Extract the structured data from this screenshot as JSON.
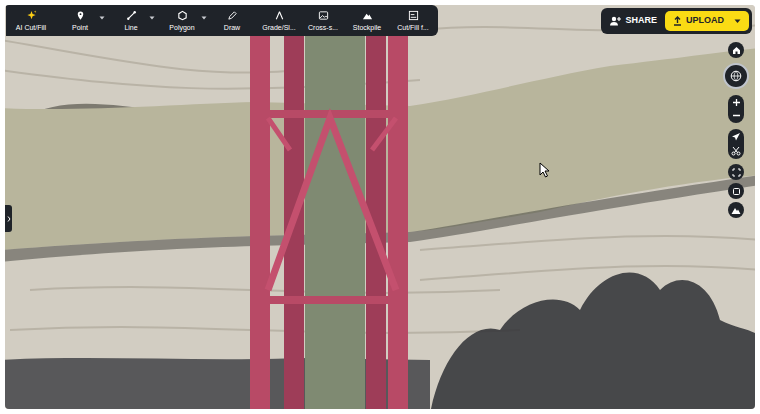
{
  "toolbar": {
    "items": [
      {
        "label": "AI Cut/Fill",
        "dropdown": false
      },
      {
        "label": "Point",
        "dropdown": true
      },
      {
        "label": "Line",
        "dropdown": true
      },
      {
        "label": "Polygon",
        "dropdown": true
      },
      {
        "label": "Draw",
        "dropdown": false
      },
      {
        "label": "Grade/Sl...",
        "dropdown": false
      },
      {
        "label": "Cross-s...",
        "dropdown": false
      },
      {
        "label": "Stockpile",
        "dropdown": false
      },
      {
        "label": "Cut/Fill f...",
        "dropdown": false
      }
    ]
  },
  "share": {
    "label": "SHARE"
  },
  "upload": {
    "label": "UPLOAD"
  }
}
